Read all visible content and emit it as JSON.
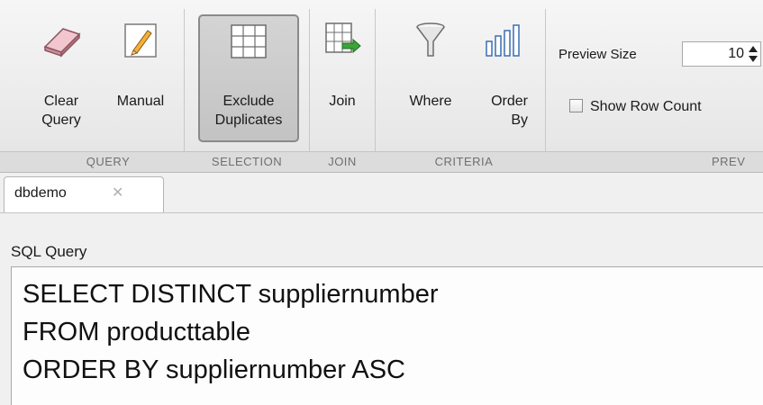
{
  "toolstrip": {
    "query": {
      "clear_query": {
        "line1": "Clear",
        "line2": "Query",
        "icon": "eraser-icon"
      },
      "manual": {
        "line1": "Manual",
        "line2": "",
        "icon": "pencil-icon"
      },
      "section_label": "QUERY"
    },
    "selection": {
      "exclude_duplicates": {
        "line1": "Exclude",
        "line2": "Duplicates",
        "icon": "table-grid-icon"
      },
      "section_label": "SELECTION"
    },
    "join": {
      "join": {
        "line1": "Join",
        "line2": "",
        "icon": "table-join-icon"
      },
      "section_label": "JOIN"
    },
    "criteria": {
      "where": {
        "line1": "Where",
        "line2": "",
        "icon": "funnel-icon"
      },
      "order_by": {
        "line1": "Order",
        "line2": "By",
        "icon": "bar-chart-icon"
      },
      "section_label": "CRITERIA"
    },
    "preview": {
      "preview_size_label": "Preview Size",
      "preview_size_value": "10",
      "show_row_count_label": "Show Row Count",
      "show_row_count_checked": false,
      "section_label": "PREV"
    }
  },
  "tabs": [
    {
      "label": "dbdemo",
      "active": true
    }
  ],
  "sql": {
    "label": "SQL Query",
    "lines": [
      "SELECT DISTINCT suppliernumber",
      "FROM producttable",
      "ORDER BY suppliernumber ASC"
    ]
  }
}
